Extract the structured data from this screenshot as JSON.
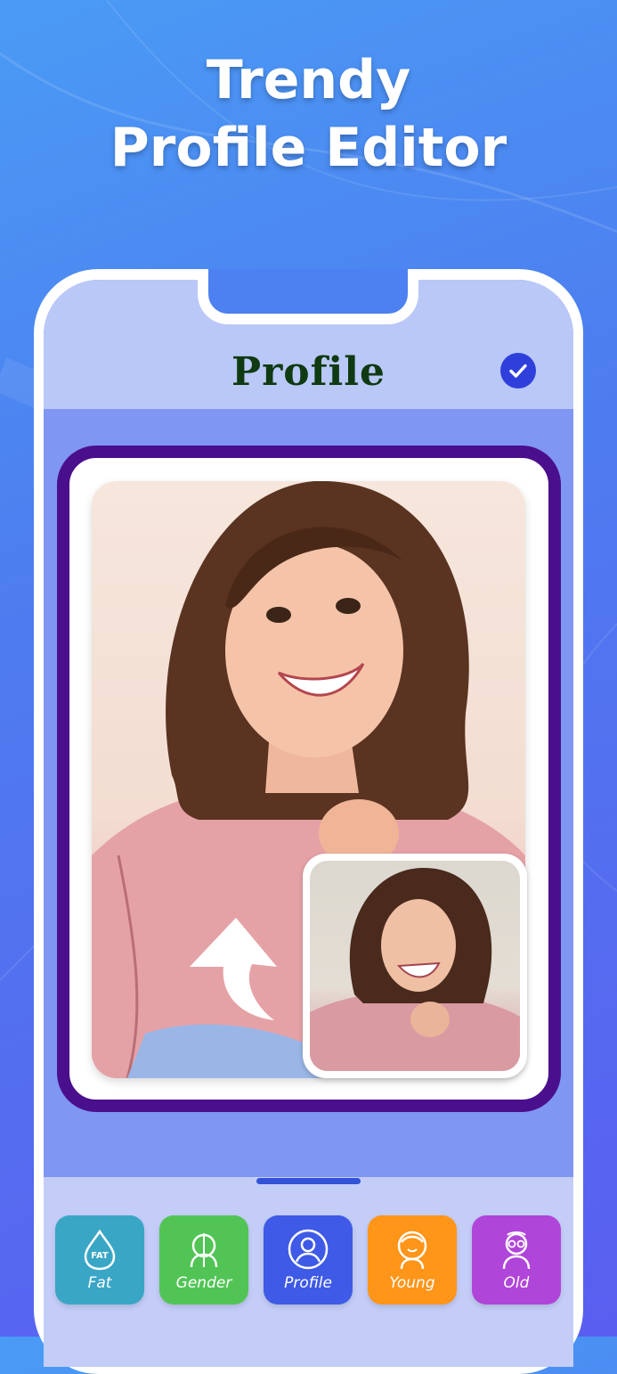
{
  "promo": {
    "line1": "Trendy",
    "line2": "Profile Editor"
  },
  "header": {
    "title": "Profile",
    "confirm_icon": "check-circle-icon"
  },
  "tools": [
    {
      "label": "Fat",
      "icon": "fat-icon",
      "color": "#3aa6c6"
    },
    {
      "label": "Gender",
      "icon": "gender-icon",
      "color": "#52c456"
    },
    {
      "label": "Profile",
      "icon": "profile-icon",
      "color": "#3f5ae6"
    },
    {
      "label": "Young",
      "icon": "young-icon",
      "color": "#ff9519"
    },
    {
      "label": "Old",
      "icon": "old-icon",
      "color": "#b045d9"
    }
  ],
  "colors": {
    "frame": "#4a0f8c",
    "accent": "#2f3fdb",
    "title": "#0f3a12"
  }
}
